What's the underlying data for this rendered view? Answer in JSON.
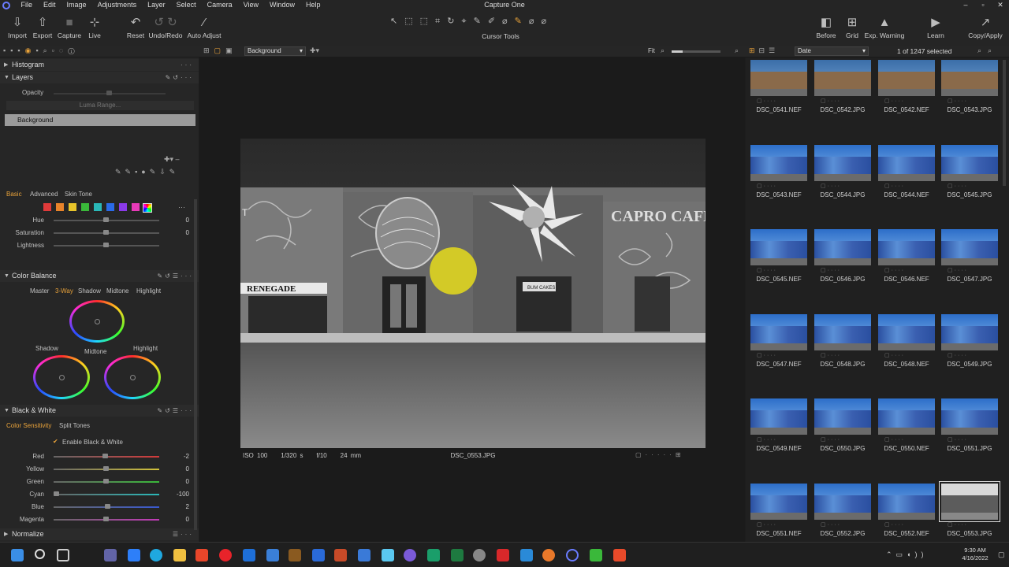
{
  "app_title": "Capture One",
  "menu": [
    "File",
    "Edit",
    "Image",
    "Adjustments",
    "Layer",
    "Select",
    "Camera",
    "View",
    "Window",
    "Help"
  ],
  "toolbar": {
    "import": "Import",
    "export": "Export",
    "capture": "Capture",
    "live": "Live",
    "reset": "Reset",
    "undo_redo": "Undo/Redo",
    "auto_adjust": "Auto Adjust",
    "cursor_tools": "Cursor Tools",
    "before": "Before",
    "grid": "Grid",
    "exp_warning": "Exp. Warning",
    "learn": "Learn",
    "copy_apply": "Copy/Apply"
  },
  "viewer_bar": {
    "layer_select": "Background",
    "fit": "Fit"
  },
  "browser_bar": {
    "sort": "Date",
    "count": "1 of 1247 selected"
  },
  "histogram": {
    "title": "Histogram"
  },
  "layers": {
    "title": "Layers",
    "opacity_label": "Opacity",
    "luma_range": "Luma Range...",
    "layer_name": "Background"
  },
  "color_editor": {
    "tabs": [
      "Basic",
      "Advanced",
      "Skin Tone"
    ],
    "swatch_colors": [
      "#e03a3a",
      "#e8832a",
      "#e8c42a",
      "#3ab83a",
      "#2ab8b8",
      "#2a6ae8",
      "#8a3ae8",
      "#e83ab8"
    ],
    "sliders": [
      {
        "label": "Hue",
        "value": "0"
      },
      {
        "label": "Saturation",
        "value": "0"
      },
      {
        "label": "Lightness",
        "value": ""
      }
    ]
  },
  "color_balance": {
    "title": "Color Balance",
    "tabs": [
      "Master",
      "3-Way",
      "Shadow",
      "Midtone",
      "Highlight"
    ],
    "wheel_labels": {
      "shadow": "Shadow",
      "midtone": "Midtone",
      "highlight": "Highlight"
    }
  },
  "black_white": {
    "title": "Black & White",
    "tabs": [
      "Color Sensitivity",
      "Split Tones"
    ],
    "enable_label": "Enable Black & White",
    "sliders": [
      {
        "label": "Red",
        "value": "-2",
        "color": "#d23a3a"
      },
      {
        "label": "Yellow",
        "value": "0",
        "color": "#d2c23a"
      },
      {
        "label": "Green",
        "value": "0",
        "color": "#3ab83a"
      },
      {
        "label": "Cyan",
        "value": "-100",
        "color": "#2ab8b8"
      },
      {
        "label": "Blue",
        "value": "2",
        "color": "#3a5ad2"
      },
      {
        "label": "Magenta",
        "value": "0",
        "color": "#c23ab8"
      }
    ]
  },
  "normalize": {
    "title": "Normalize"
  },
  "photo_info": {
    "iso": "ISO 100",
    "shutter": "1/320 s",
    "aperture": "f/10",
    "focal": "24 mm",
    "filename": "DSC_0553.JPG"
  },
  "photo_signs": {
    "left": "RENEGADE",
    "right": "CAPRO CAFE",
    "door": "BUM CAKES",
    "t": "T"
  },
  "thumbnails": [
    "DSC_0541.NEF",
    "DSC_0542.JPG",
    "DSC_0542.NEF",
    "DSC_0543.JPG",
    "DSC_0543.NEF",
    "DSC_0544.JPG",
    "DSC_0544.NEF",
    "DSC_0545.JPG",
    "DSC_0545.NEF",
    "DSC_0546.JPG",
    "DSC_0546.NEF",
    "DSC_0547.JPG",
    "DSC_0547.NEF",
    "DSC_0548.JPG",
    "DSC_0548.NEF",
    "DSC_0549.JPG",
    "DSC_0549.NEF",
    "DSC_0550.JPG",
    "DSC_0550.NEF",
    "DSC_0551.JPG",
    "DSC_0551.NEF",
    "DSC_0552.JPG",
    "DSC_0552.NEF",
    "DSC_0553.JPG"
  ],
  "clock": {
    "time": "9:30 AM",
    "date": "4/16/2022"
  }
}
